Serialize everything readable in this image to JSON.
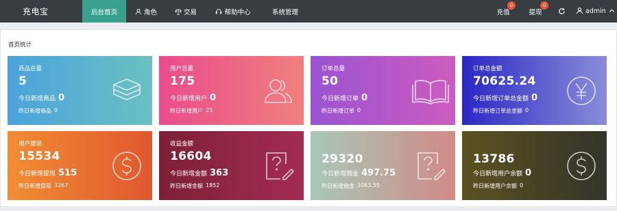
{
  "app": {
    "brand": "充电宝"
  },
  "nav": [
    {
      "label": "后台首页",
      "icon": "none",
      "active": true
    },
    {
      "label": "角色",
      "icon": "user-icon"
    },
    {
      "label": "交易",
      "icon": "scale-icon"
    },
    {
      "label": "帮助中心",
      "icon": "headset-icon"
    },
    {
      "label": "系统管理",
      "icon": "none"
    }
  ],
  "header_right": {
    "recharge": {
      "label": "充值",
      "badge": "0"
    },
    "withdraw": {
      "label": "提现",
      "badge": "0"
    },
    "refresh_icon": "refresh-icon",
    "user": {
      "name": "admin",
      "icon": "user-icon",
      "caret": "chevron-up-icon"
    }
  },
  "panel": {
    "title": "首页统计"
  },
  "cards": [
    {
      "label": "商品总量",
      "value": "5",
      "today_label": "今日新增商品",
      "today_value": "0",
      "yest_label": "昨日新增商品",
      "yest_value": "0",
      "icon": "layers-icon"
    },
    {
      "label": "用户总量",
      "value": "175",
      "today_label": "今日新增用户",
      "today_value": "0",
      "yest_label": "昨日新增用户",
      "yest_value": "25",
      "icon": "users-icon"
    },
    {
      "label": "订单总量",
      "value": "50",
      "today_label": "今日新增订单",
      "today_value": "0",
      "yest_label": "昨日新增订单",
      "yest_value": "0",
      "icon": "book-icon"
    },
    {
      "label": "订单总金额",
      "value": "70625.24",
      "today_label": "今日新增订单总金额",
      "today_value": "0",
      "yest_label": "昨日新增订单总金额",
      "yest_value": "0",
      "icon": "yen-icon"
    },
    {
      "label": "用户提现",
      "value": "15534",
      "today_label": "今日新增提现",
      "today_value": "515",
      "yest_label": "昨日新增提现",
      "yest_value": "3267",
      "icon": "dollar-icon"
    },
    {
      "label": "收益金额",
      "value": "16604",
      "today_label": "今日新增金额",
      "today_value": "363",
      "yest_label": "昨日新增金额",
      "yest_value": "1852",
      "icon": "question-edit-icon"
    },
    {
      "label": "",
      "value": "29320",
      "today_label": "今日新增佣金",
      "today_value": "497.75",
      "yest_label": "昨日新增佣金",
      "yest_value": "3063.55",
      "icon": "question-edit-icon"
    },
    {
      "label": "",
      "value": "13786",
      "today_label": "今日新增用户余额",
      "today_value": "0",
      "yest_label": "昨日新增用户余额",
      "yest_value": "0",
      "icon": "dollar-icon"
    }
  ]
}
